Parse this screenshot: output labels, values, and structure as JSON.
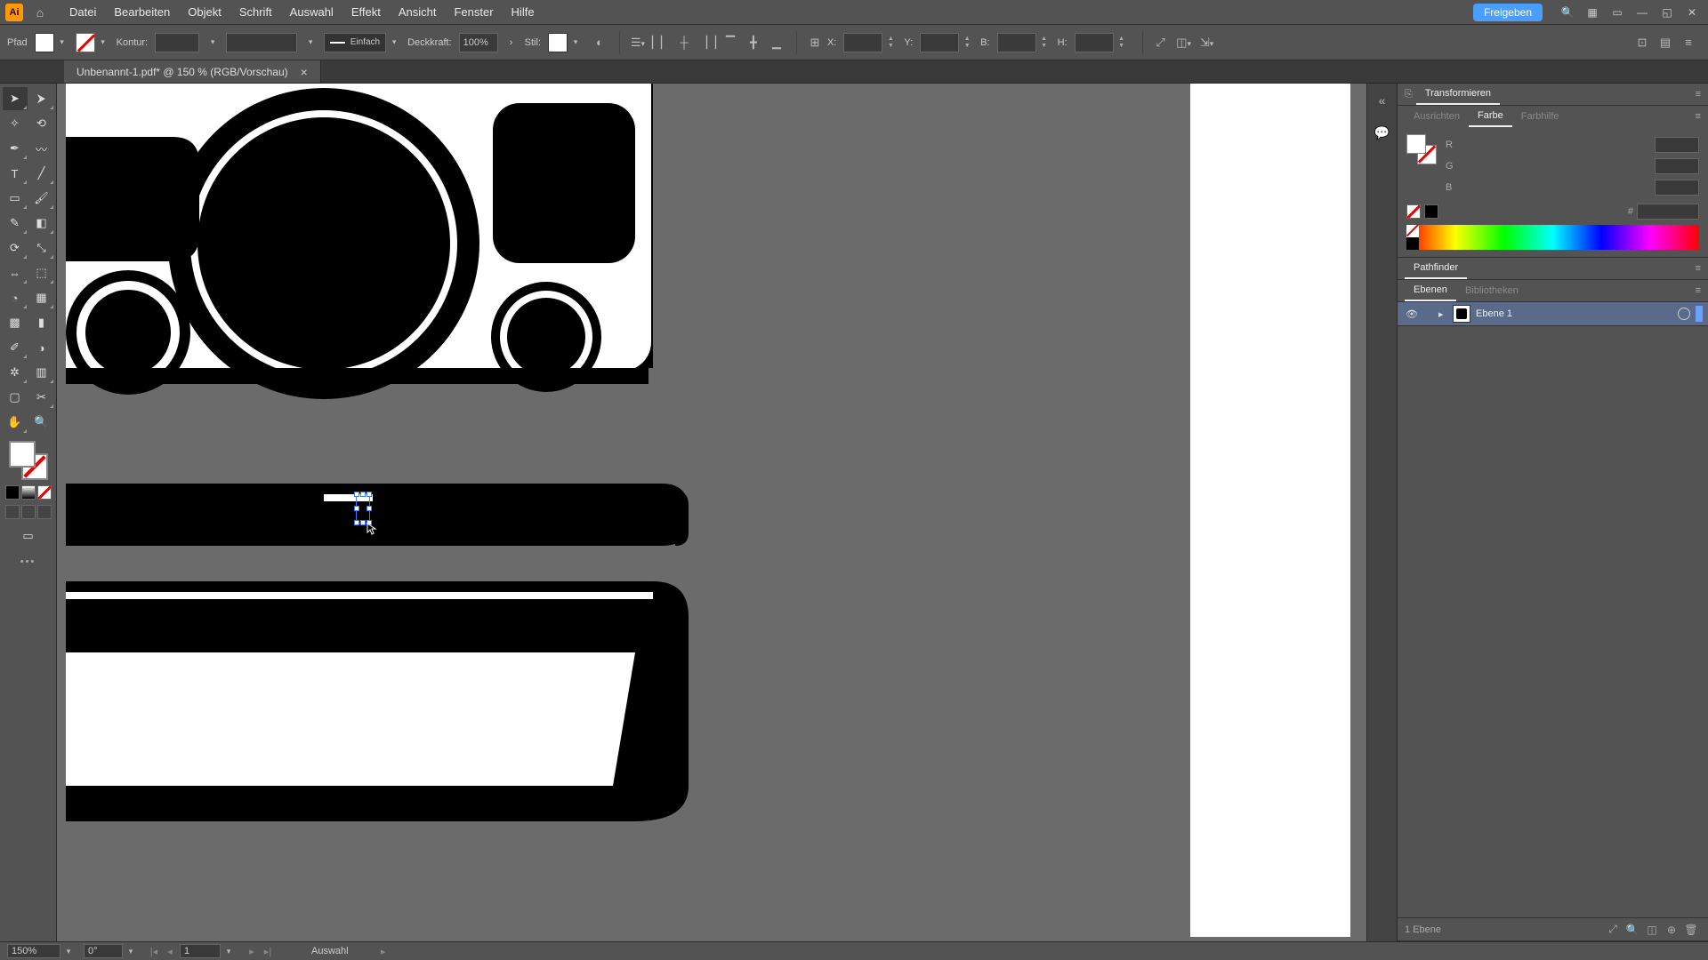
{
  "menubar": {
    "app_badge": "Ai",
    "items": [
      "Datei",
      "Bearbeiten",
      "Objekt",
      "Schrift",
      "Auswahl",
      "Effekt",
      "Ansicht",
      "Fenster",
      "Hilfe"
    ],
    "share_label": "Freigeben"
  },
  "controlbar": {
    "mode_label": "Pfad",
    "stroke_label": "Kontur:",
    "stroke_weight": "",
    "brush_value": "Einfach",
    "opacity_label": "Deckkraft:",
    "opacity_value": "100%",
    "style_label": "Stil:",
    "x_label": "X:",
    "x_value": "",
    "y_label": "Y:",
    "y_value": "",
    "w_label": "B:",
    "w_value": "",
    "h_label": "H:",
    "h_value": ""
  },
  "tab": {
    "title": "Unbenannt-1.pdf* @ 150 % (RGB/Vorschau)"
  },
  "panels": {
    "transform_title": "Transformieren",
    "align_tab": "Ausrichten",
    "color_tab": "Farbe",
    "guide_tab": "Farbhilfe",
    "r_label": "R",
    "g_label": "G",
    "b_label": "B",
    "hex_label": "#",
    "pathfinder_title": "Pathfinder",
    "layers_tab": "Ebenen",
    "libraries_tab": "Bibliotheken",
    "layer1_name": "Ebene 1",
    "layer_count": "1 Ebene"
  },
  "statusbar": {
    "zoom": "150%",
    "rotate": "0°",
    "artboard": "1",
    "tool": "Auswahl"
  }
}
